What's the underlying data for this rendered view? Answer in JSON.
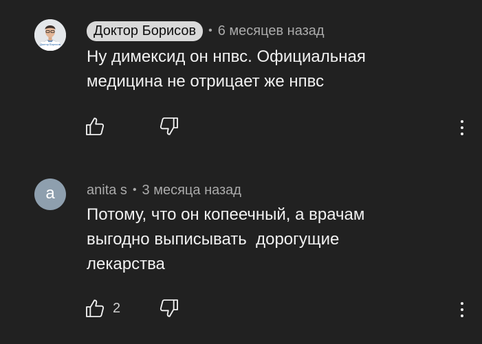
{
  "comments": [
    {
      "author": "Доктор Борисов",
      "avatar_caption": "Доктор Борисов",
      "separator": "•",
      "time": "6 месяцев назад",
      "lines": [
        "Ну димексид он нпвс. Официальная",
        "медицина не отрицает же нпвс"
      ],
      "like_count": "",
      "icons": {
        "like": "thumb-up-icon",
        "dislike": "thumb-down-icon",
        "more": "more-vert-icon"
      }
    },
    {
      "author": "anita s",
      "avatar_letter": "a",
      "separator": "•",
      "time": "3 месяца назад",
      "lines": [
        "Потому, что он копеечный, а врачам",
        "выгодно выписывать  дорогущие",
        "лекарства"
      ],
      "like_count": "2",
      "icons": {
        "like": "thumb-up-icon",
        "dislike": "thumb-down-icon",
        "more": "more-vert-icon"
      }
    }
  ],
  "colors": {
    "background": "#212121",
    "text": "#f1f1f1",
    "meta": "#aaaaaa",
    "author_chip": "#d9d9d9",
    "avatar_letter_bg": "#8e9fae"
  }
}
